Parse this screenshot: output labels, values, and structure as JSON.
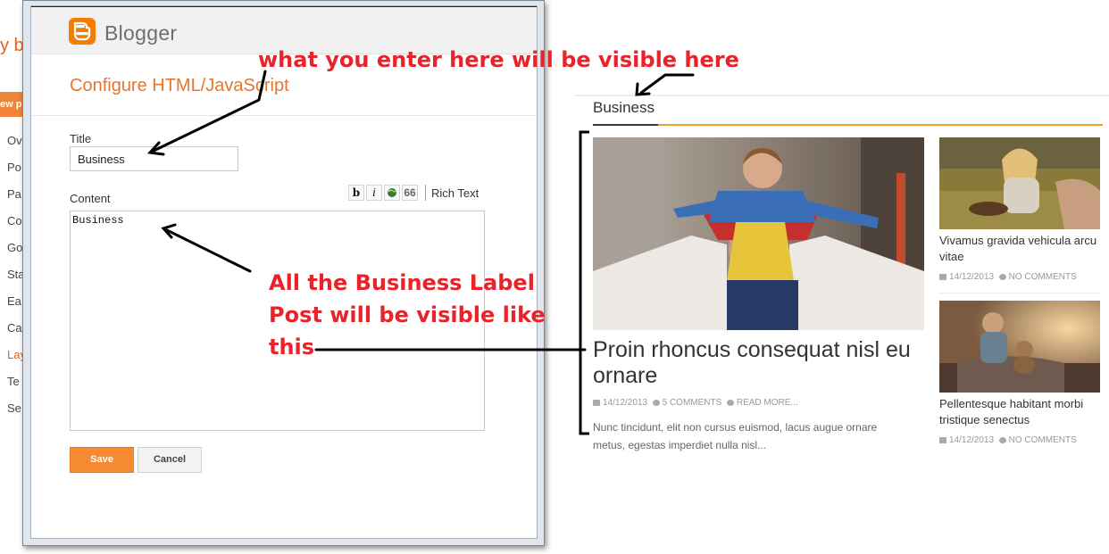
{
  "background_app": {
    "brand_partial": "y b",
    "new_post_partial": "ew p",
    "menu": [
      "Ov",
      "Po",
      "Pa",
      "Co",
      "Go",
      "Sta",
      "Ea",
      "Ca",
      "Lay",
      "Te",
      "Se"
    ],
    "active_index": 8
  },
  "dialog": {
    "brand": "Blogger",
    "heading": "Configure HTML/JavaScript",
    "title_label": "Title",
    "title_value": "Business",
    "content_label": "Content",
    "toolbar": {
      "bold": "b",
      "italic": "i",
      "quote": "66",
      "rich_text": "Rich Text"
    },
    "content_value": "Business",
    "save_label": "Save",
    "cancel_label": "Cancel"
  },
  "widget": {
    "title": "Business",
    "main_post": {
      "title": "Proin rhoncus consequat nisl eu ornare",
      "date": "14/12/2013",
      "comments": "5 COMMENTS",
      "read_more": "READ MORE...",
      "excerpt": "Nunc tincidunt, elit non cursus euismod, lacus augue ornare metus, egestas imperdiet nulla nisl..."
    },
    "side_posts": [
      {
        "title": "Vivamus gravida vehicula arcu vitae",
        "date": "14/12/2013",
        "comments": "NO COMMENTS"
      },
      {
        "title": "Pellentesque habitant morbi tristique senectus",
        "date": "14/12/2013",
        "comments": "NO COMMENTS"
      }
    ]
  },
  "annotations": {
    "top": "what you enter here will be visible here",
    "middle_line1": "All the Business Label",
    "middle_line2": "Post will be visible like",
    "middle_line3": "this"
  },
  "colors": {
    "accent_orange": "#f68a32",
    "annotation_red": "#e8232a",
    "blogger_orange": "#f57d00"
  }
}
